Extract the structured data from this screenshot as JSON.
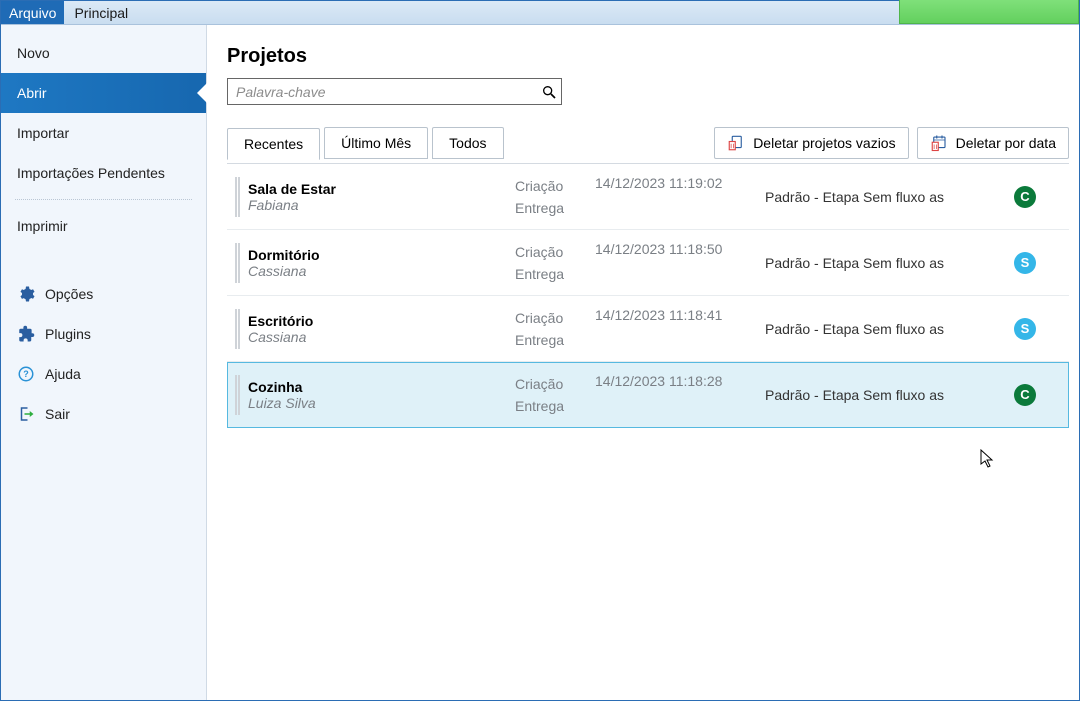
{
  "ribbon": {
    "file_tab": "Arquivo",
    "main_tab": "Principal"
  },
  "sidebar": {
    "items": [
      {
        "label": "Novo",
        "icon": ""
      },
      {
        "label": "Abrir",
        "icon": "",
        "active": true
      },
      {
        "label": "Importar",
        "icon": ""
      },
      {
        "label": "Importações Pendentes",
        "icon": ""
      },
      {
        "label": "Imprimir",
        "icon": ""
      },
      {
        "label": "Opções",
        "icon": "gear"
      },
      {
        "label": "Plugins",
        "icon": "puzzle"
      },
      {
        "label": "Ajuda",
        "icon": "help"
      },
      {
        "label": "Sair",
        "icon": "exit"
      }
    ]
  },
  "page": {
    "title": "Projetos",
    "search_placeholder": "Palavra-chave"
  },
  "tabs": {
    "recentes": "Recentes",
    "ultimo_mes": "Último Mês",
    "todos": "Todos"
  },
  "toolbar_buttons": {
    "delete_empty": "Deletar projetos vazios",
    "delete_by_date": "Deletar por data"
  },
  "col_labels": {
    "criacao": "Criação",
    "entrega": "Entrega"
  },
  "projects": [
    {
      "name": "Sala de Estar",
      "owner": "Fabiana",
      "created": "14/12/2023 11:19:02",
      "flow": "Padrão - Etapa Sem fluxo as",
      "badge": "C",
      "badge_color": "c"
    },
    {
      "name": "Dormitório",
      "owner": "Cassiana",
      "created": "14/12/2023 11:18:50",
      "flow": "Padrão - Etapa Sem fluxo as",
      "badge": "S",
      "badge_color": "s"
    },
    {
      "name": "Escritório",
      "owner": "Cassiana",
      "created": "14/12/2023 11:18:41",
      "flow": "Padrão - Etapa Sem fluxo as",
      "badge": "S",
      "badge_color": "s"
    },
    {
      "name": "Cozinha",
      "owner": "Luiza Silva",
      "created": "14/12/2023 11:18:28",
      "flow": "Padrão - Etapa Sem fluxo as",
      "badge": "C",
      "badge_color": "c",
      "selected": true
    }
  ]
}
